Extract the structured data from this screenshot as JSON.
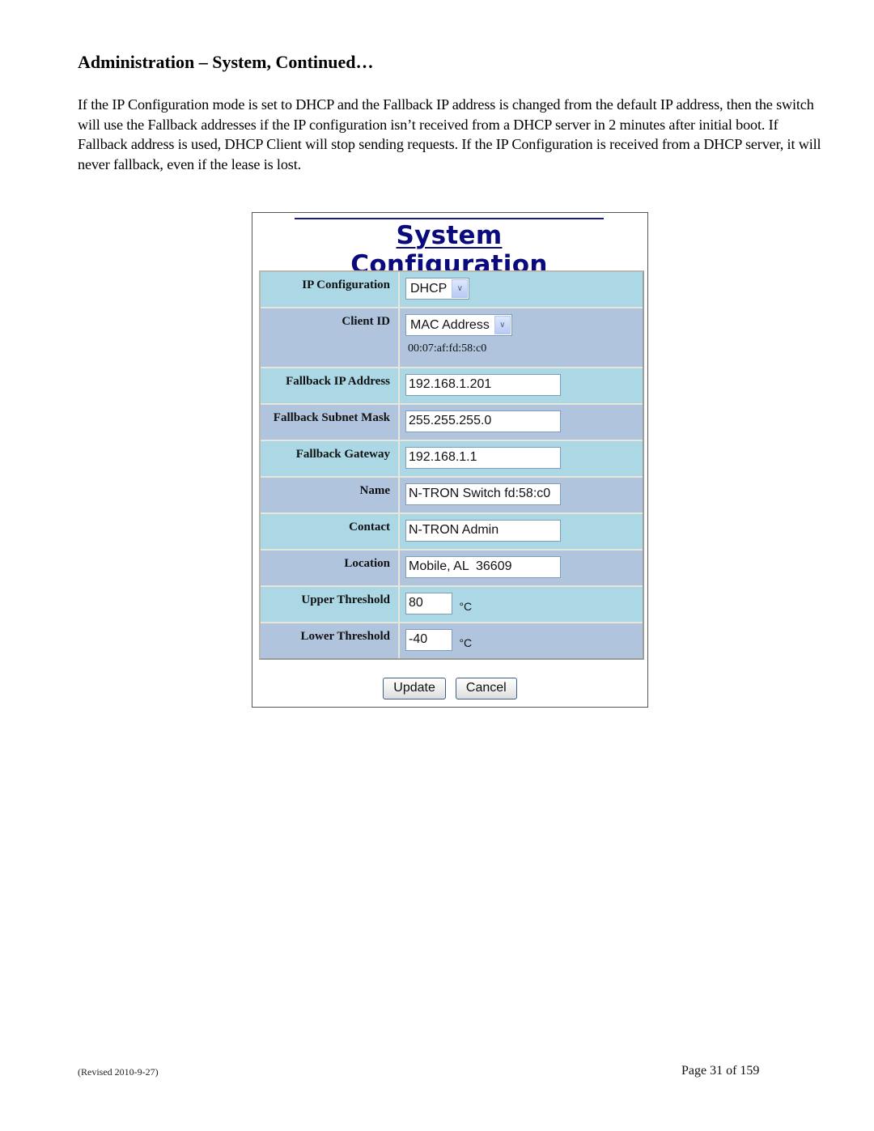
{
  "document": {
    "heading": "Administration – System, Continued…",
    "paragraph": "If the IP Configuration mode is set to DHCP and the Fallback IP address is changed from the default IP address, then the switch will use the Fallback addresses if the IP configuration isn’t received from a DHCP server in 2 minutes after initial boot.  If Fallback address is used, DHCP Client will stop sending requests. If the IP Configuration is received from a DHCP server, it will never fallback, even if the lease is lost.",
    "footer_revised": "(Revised 2010-9-27)",
    "footer_page": "Page 31 of 159"
  },
  "screenshot": {
    "title": "System Configuration",
    "fields": {
      "ip_configuration": {
        "label": "IP Configuration",
        "value": "DHCP"
      },
      "client_id": {
        "label": "Client ID",
        "value": "MAC Address",
        "mac": "00:07:af:fd:58:c0"
      },
      "fallback_ip": {
        "label": "Fallback IP Address",
        "value": "192.168.1.201"
      },
      "fallback_subnet": {
        "label": "Fallback Subnet Mask",
        "value": "255.255.255.0"
      },
      "fallback_gateway": {
        "label": "Fallback Gateway",
        "value": "192.168.1.1"
      },
      "name": {
        "label": "Name",
        "value": "N-TRON Switch fd:58:c0"
      },
      "contact": {
        "label": "Contact",
        "value": "N-TRON Admin"
      },
      "location": {
        "label": "Location",
        "value": "Mobile, AL  36609"
      },
      "upper_threshold": {
        "label": "Upper Threshold",
        "value": "80",
        "unit": "°C"
      },
      "lower_threshold": {
        "label": "Lower Threshold",
        "value": "-40",
        "unit": "°C"
      }
    },
    "buttons": {
      "update": "Update",
      "cancel": "Cancel"
    },
    "icons": {
      "dropdown": "chevron-down-icon"
    },
    "colors": {
      "row_light": "#acd8e6",
      "row_dark": "#b0c4de",
      "title": "#0a0a7c"
    }
  }
}
